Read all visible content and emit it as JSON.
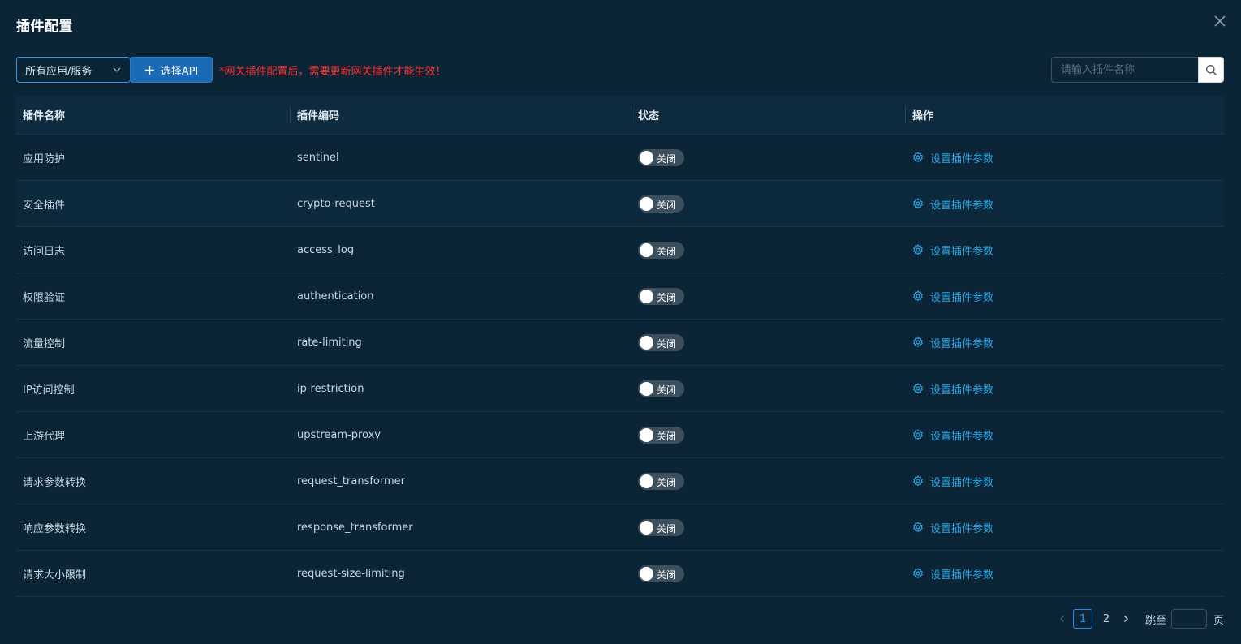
{
  "dialog": {
    "title": "插件配置",
    "close_icon": "close-icon"
  },
  "toolbar": {
    "app_select_value": "所有应用/服务",
    "select_api_label": "选择API",
    "warning": "*网关插件配置后，需要更新网关插件才能生效！",
    "search_placeholder": "请输入插件名称",
    "search_icon": "search-icon"
  },
  "colors": {
    "background": "#0b2537",
    "accent": "#1b6ab5",
    "link": "#2aa8e8",
    "warning": "#ff2f2f"
  },
  "table": {
    "headers": {
      "name": "插件名称",
      "code": "插件编码",
      "status": "状态",
      "action": "操作"
    },
    "rows": [
      {
        "name": "应用防护",
        "code": "sentinel",
        "status": "关闭",
        "action": "设置插件参数"
      },
      {
        "name": "安全插件",
        "code": "crypto-request",
        "status": "关闭",
        "action": "设置插件参数"
      },
      {
        "name": "访问日志",
        "code": "access_log",
        "status": "关闭",
        "action": "设置插件参数"
      },
      {
        "name": "权限验证",
        "code": "authentication",
        "status": "关闭",
        "action": "设置插件参数"
      },
      {
        "name": "流量控制",
        "code": "rate-limiting",
        "status": "关闭",
        "action": "设置插件参数"
      },
      {
        "name": "IP访问控制",
        "code": "ip-restriction",
        "status": "关闭",
        "action": "设置插件参数"
      },
      {
        "name": "上游代理",
        "code": "upstream-proxy",
        "status": "关闭",
        "action": "设置插件参数"
      },
      {
        "name": "请求参数转换",
        "code": "request_transformer",
        "status": "关闭",
        "action": "设置插件参数"
      },
      {
        "name": "响应参数转换",
        "code": "response_transformer",
        "status": "关闭",
        "action": "设置插件参数"
      },
      {
        "name": "请求大小限制",
        "code": "request-size-limiting",
        "status": "关闭",
        "action": "设置插件参数"
      }
    ]
  },
  "pagination": {
    "pages": [
      "1",
      "2"
    ],
    "current": "1",
    "jump_label": "跳至",
    "page_unit": "页"
  }
}
